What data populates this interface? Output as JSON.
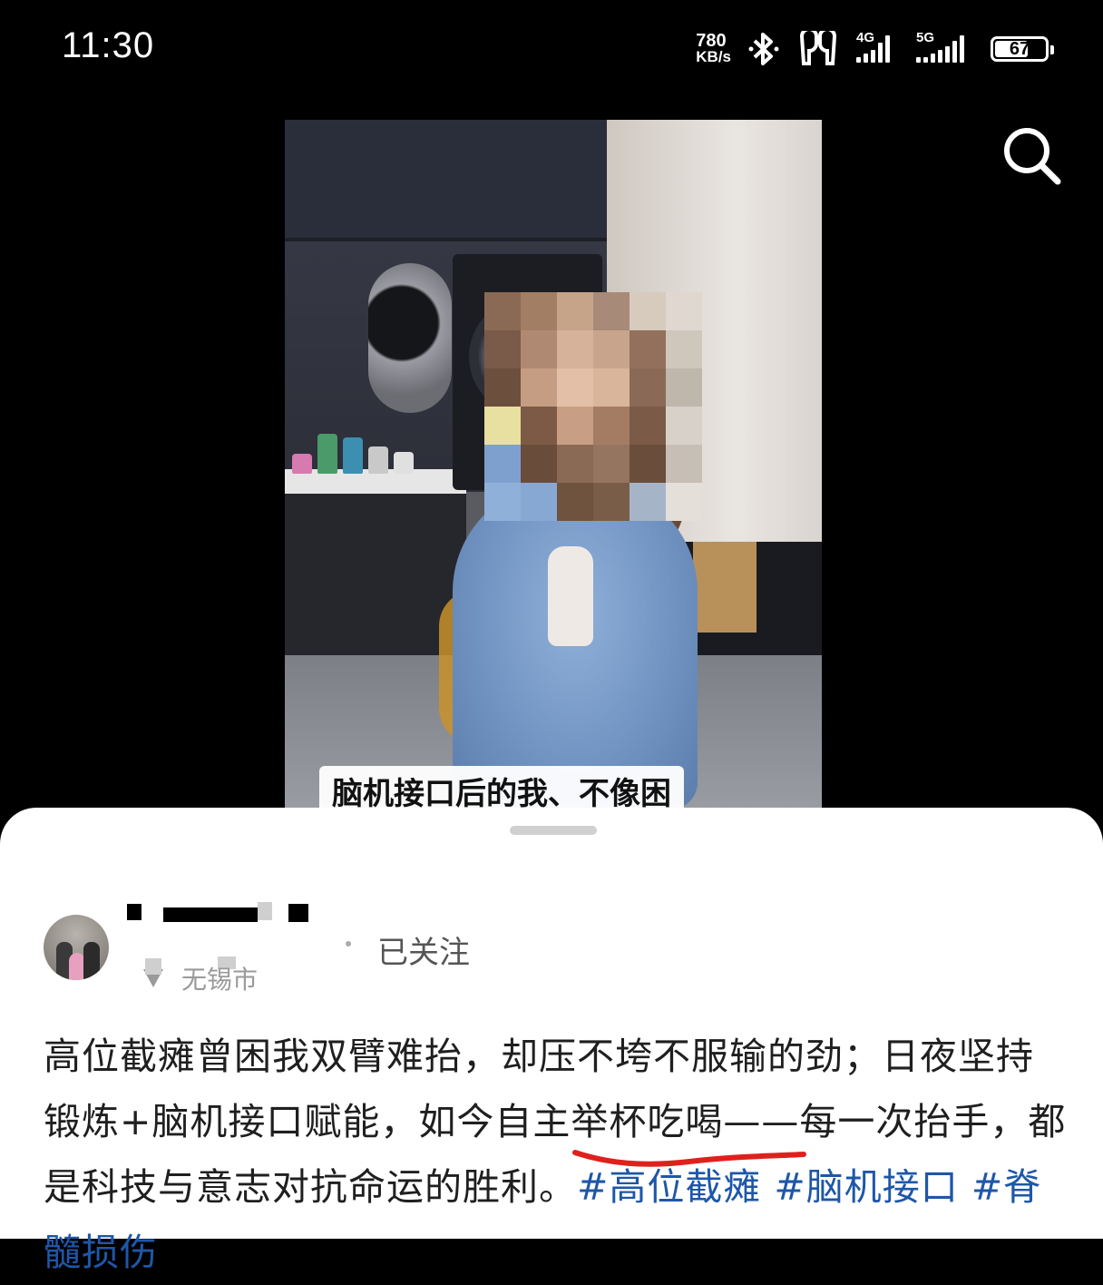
{
  "status_bar": {
    "time": "11:30",
    "net_speed_value": "780",
    "net_speed_unit": "KB/s",
    "network_1": "4G",
    "network_2": "5G",
    "battery": "67"
  },
  "video": {
    "caption": "脑机接口后的我、不像困"
  },
  "post": {
    "author_name": " ",
    "follow_status": "已关注",
    "location": "无锡市",
    "text_main": "高位截瘫曾困我双臂难抬，却压不垮不服输的劲；日夜坚持锻炼+脑机接口赋能，如今自主举杯吃喝——每一次抬手，都是科技与意志对抗命运的胜利。",
    "hashtag_1": "#高位截瘫",
    "hashtag_2": "#脑机接口",
    "hashtag_3": "#脊髓损伤"
  },
  "icons": {
    "search": "search-icon",
    "bluetooth": "bluetooth-icon",
    "earbuds": "earbuds-icon",
    "location": "location-pin-icon"
  },
  "colors": {
    "hashtag": "#1e57a8",
    "annotation": "#e0201c"
  }
}
